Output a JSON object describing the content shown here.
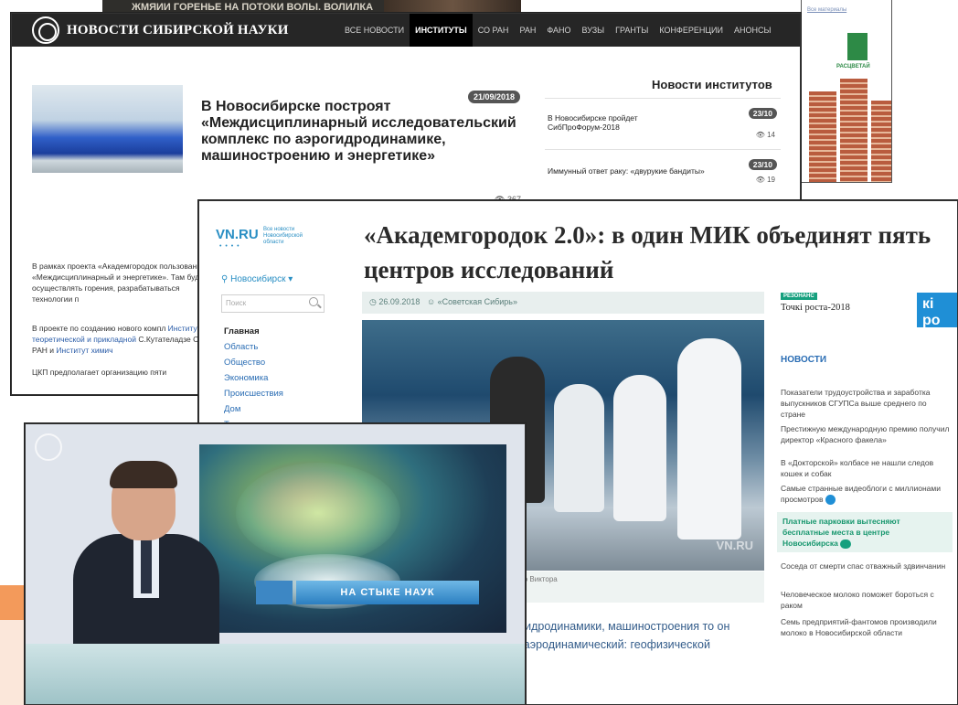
{
  "top_strip": {
    "text": "ЖМЯИИ ГОРЕНЬЕ НА ПОТОКИ ВОЛЫ. ВОЛИЛКА"
  },
  "ad": {
    "link": "Все материалы",
    "brand": "РАСЦВЕТАЙ"
  },
  "institute_site": {
    "logo_text": "НОВОСТИ СИБИРСКОЙ НАУКИ",
    "menu": [
      {
        "label": "Все новости",
        "active": false
      },
      {
        "label": "Институты",
        "active": true
      },
      {
        "label": "СО РАН",
        "active": false
      },
      {
        "label": "РАН",
        "active": false
      },
      {
        "label": "ФАНО",
        "active": false
      },
      {
        "label": "Вузы",
        "active": false
      },
      {
        "label": "Гранты",
        "active": false
      },
      {
        "label": "Конференции",
        "active": false
      },
      {
        "label": "Анонсы",
        "active": false
      }
    ],
    "article": {
      "date": "21/09/2018",
      "headline": "В Новосибирске построят «Междисциплинарный исследовательский комплекс по аэрогидродинамике, машиностроению и энергетике»",
      "views": "367",
      "body_p1": "В рамках проекта «Академгородок пользования «Междисциплинарный и энергетике». Там будут осуществлять горения, разрабатываться технологии п",
      "body_p2_a": "В проекте по созданию нового компл",
      "body_p2_link1": "Институт теоретической и прикладной",
      "body_p2_b": "С.Кутателадзе СО РАН и ",
      "body_p2_link2": "Институт химич",
      "body_p3": "ЦКП предполагает организацию пяти"
    },
    "sidebar": {
      "title": "Новости институтов",
      "items": [
        {
          "title": "В Новосибирске пройдет СибПроФорум-2018",
          "date": "23/10",
          "views": "14"
        },
        {
          "title": "Иммунный ответ раку: «двурукие бандиты»",
          "date": "23/10",
          "views": "19"
        }
      ]
    }
  },
  "vn_site": {
    "logo": "VN.RU",
    "tagline": "Все новости Новосибирской области",
    "city": "Новосибирск",
    "search_placeholder": "Поиск",
    "nav": [
      "Главная",
      "Область",
      "Общество",
      "Экономика",
      "Происшествия",
      "Дом",
      "Транспорт"
    ],
    "headline": "«Академгородок 2.0»: в один МИК объединят пять центров исследований",
    "meta_date": "26.09.2018",
    "meta_source": "«Советская Сибирь»",
    "photo_watermark": "VN.RU",
    "photo_caption": "т проводить исследования на стыке наук. Фото Виктора",
    "lede": "ь междисциплинарный с аэрогидродинамики, машиностроения то он объединит пять современных аэродинамический: геофизической",
    "resonance_badge": "РЕЗОНАНС",
    "resonance_title": "Точкі роста-2018",
    "resonance_logo": "кі ро",
    "news_title": "НОВОСТИ",
    "news": [
      {
        "text": "Показатели трудоустройства и заработка выпускников СГУПСа выше среднего по стране",
        "highlight": false
      },
      {
        "text": "Престижную международную премию получил директор «Красного факела»",
        "highlight": false
      },
      {
        "text": "В «Докторской» колбасе не нашли следов кошек и собак",
        "highlight": false
      },
      {
        "text": "Самые странные видеоблоги с миллионами просмотров",
        "highlight": false
      },
      {
        "text": "Платные парковки вытесняют бесплатные места в центре Новосибирска",
        "highlight": true
      },
      {
        "text": "Соседа от смерти спас отважный здвинчанин",
        "highlight": false
      },
      {
        "text": "Человеческое молоко поможет бороться с раком",
        "highlight": false
      },
      {
        "text": "Семь предприятий-фантомов производили молоко в Новосибирской области",
        "highlight": false
      }
    ]
  },
  "tv": {
    "banner": "НА СТЫКЕ НАУК"
  },
  "colors": {
    "accent_orange": "#f39a5b",
    "vn_blue": "#2a8fc4",
    "vn_green": "#16a07e",
    "nav_dark": "#262626"
  }
}
